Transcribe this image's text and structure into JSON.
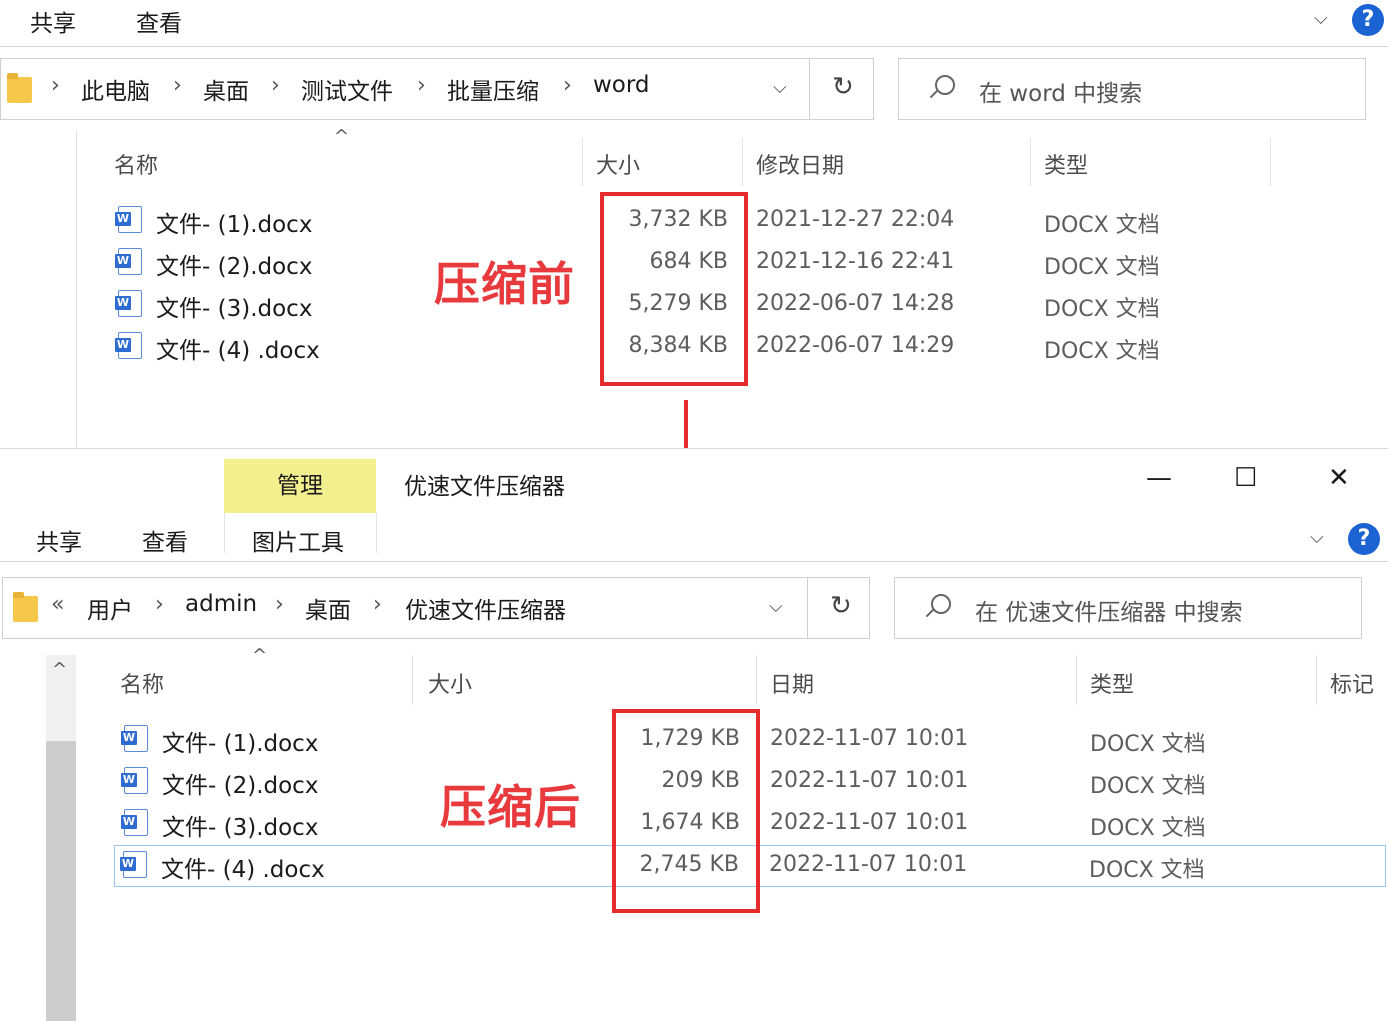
{
  "top": {
    "ribbon_tabs": [
      "共享",
      "查看"
    ],
    "address": {
      "crumbs": [
        "此电脑",
        "桌面",
        "测试文件",
        "批量压缩",
        "word"
      ],
      "search_placeholder": "在 word 中搜索"
    },
    "columns": [
      "名称",
      "大小",
      "修改日期",
      "类型"
    ],
    "files": [
      {
        "name": "文件- (1).docx",
        "size": "3,732 KB",
        "date": "2021-12-27 22:04",
        "type": "DOCX 文档"
      },
      {
        "name": "文件- (2).docx",
        "size": "684 KB",
        "date": "2021-12-16 22:41",
        "type": "DOCX 文档"
      },
      {
        "name": "文件- (3).docx",
        "size": "5,279 KB",
        "date": "2022-06-07 14:28",
        "type": "DOCX 文档"
      },
      {
        "name": "文件- (4) .docx",
        "size": "8,384 KB",
        "date": "2022-06-07 14:29",
        "type": "DOCX 文档"
      }
    ],
    "annotation": "压缩前"
  },
  "bottom": {
    "context_tab": "管理",
    "window_title": "优速文件压缩器",
    "ribbon_tabs": [
      "共享",
      "查看",
      "图片工具"
    ],
    "address": {
      "overflow": "«",
      "crumbs": [
        "用户",
        "admin",
        "桌面",
        "优速文件压缩器"
      ],
      "search_placeholder": "在 优速文件压缩器 中搜索"
    },
    "columns": [
      "名称",
      "大小",
      "日期",
      "类型",
      "标记"
    ],
    "files": [
      {
        "name": "文件- (1).docx",
        "size": "1,729 KB",
        "date": "2022-11-07 10:01",
        "type": "DOCX 文档"
      },
      {
        "name": "文件- (2).docx",
        "size": "209 KB",
        "date": "2022-11-07 10:01",
        "type": "DOCX 文档"
      },
      {
        "name": "文件- (3).docx",
        "size": "1,674 KB",
        "date": "2022-11-07 10:01",
        "type": "DOCX 文档"
      },
      {
        "name": "文件- (4) .docx",
        "size": "2,745 KB",
        "date": "2022-11-07 10:01",
        "type": "DOCX 文档"
      }
    ],
    "annotation": "压缩后"
  },
  "icons": {
    "help": "?",
    "word_letter": "W",
    "refresh": "↻",
    "dropdown": "⌵",
    "expand": "⌵",
    "minimize": "—",
    "maximize": "☐",
    "close": "✕",
    "sort": "^",
    "breadcrumb_sep": "›",
    "scroll_up": "^"
  },
  "colors": {
    "annotation_red": "#e52b2b",
    "context_tab_yellow": "#f3ef8f",
    "help_blue": "#1b62d2",
    "word_blue": "#2f6cd1"
  }
}
